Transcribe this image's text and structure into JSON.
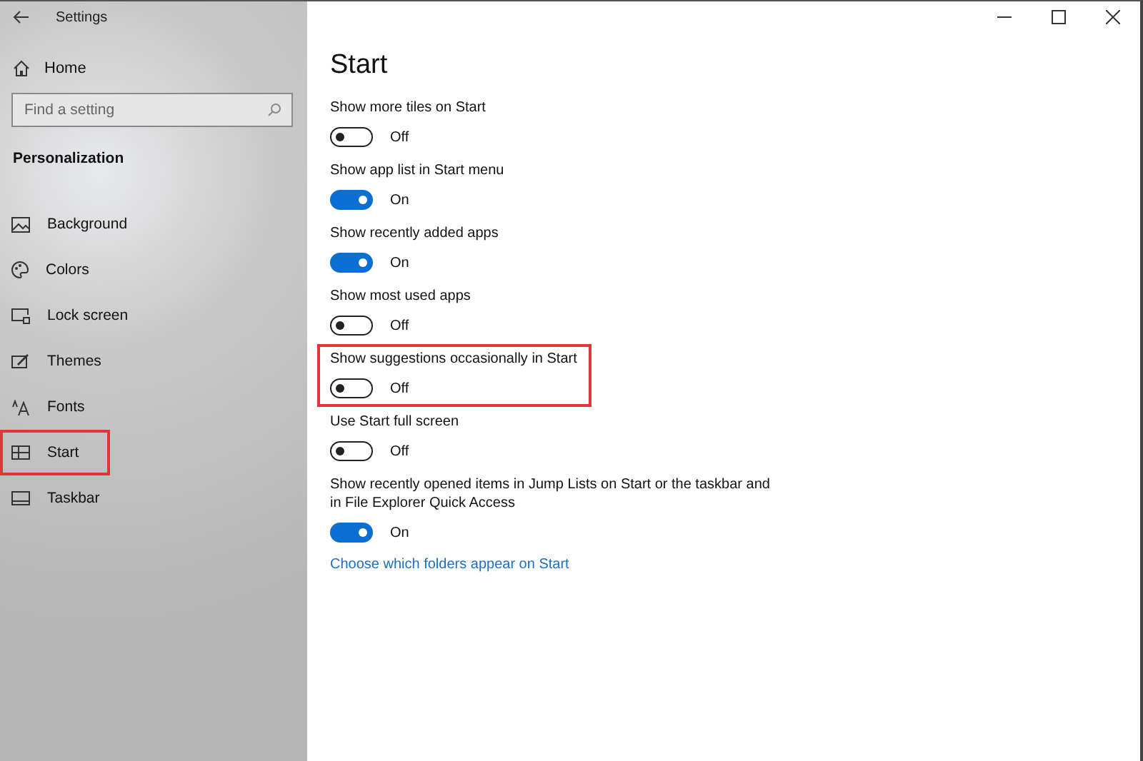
{
  "window": {
    "title": "Settings"
  },
  "sidebar": {
    "home": "Home",
    "search": {
      "placeholder": "Find a setting"
    },
    "section": "Personalization",
    "items": [
      {
        "label": "Background",
        "highlighted": false
      },
      {
        "label": "Colors",
        "highlighted": false
      },
      {
        "label": "Lock screen",
        "highlighted": false
      },
      {
        "label": "Themes",
        "highlighted": false
      },
      {
        "label": "Fonts",
        "highlighted": false
      },
      {
        "label": "Start",
        "highlighted": true
      },
      {
        "label": "Taskbar",
        "highlighted": false
      }
    ]
  },
  "page": {
    "title": "Start",
    "settings": [
      {
        "label": "Show more tiles on Start",
        "on": false,
        "state": "Off",
        "highlighted": false
      },
      {
        "label": "Show app list in Start menu",
        "on": true,
        "state": "On",
        "highlighted": false
      },
      {
        "label": "Show recently added apps",
        "on": true,
        "state": "On",
        "highlighted": false
      },
      {
        "label": "Show most used apps",
        "on": false,
        "state": "Off",
        "highlighted": false
      },
      {
        "label": "Show suggestions occasionally in Start",
        "on": false,
        "state": "Off",
        "highlighted": true
      },
      {
        "label": "Use Start full screen",
        "on": false,
        "state": "Off",
        "highlighted": false
      },
      {
        "label": "Show recently opened items in Jump Lists on Start or the taskbar and in File Explorer Quick Access",
        "on": true,
        "state": "On",
        "highlighted": false
      }
    ],
    "link": "Choose which folders appear on Start"
  }
}
